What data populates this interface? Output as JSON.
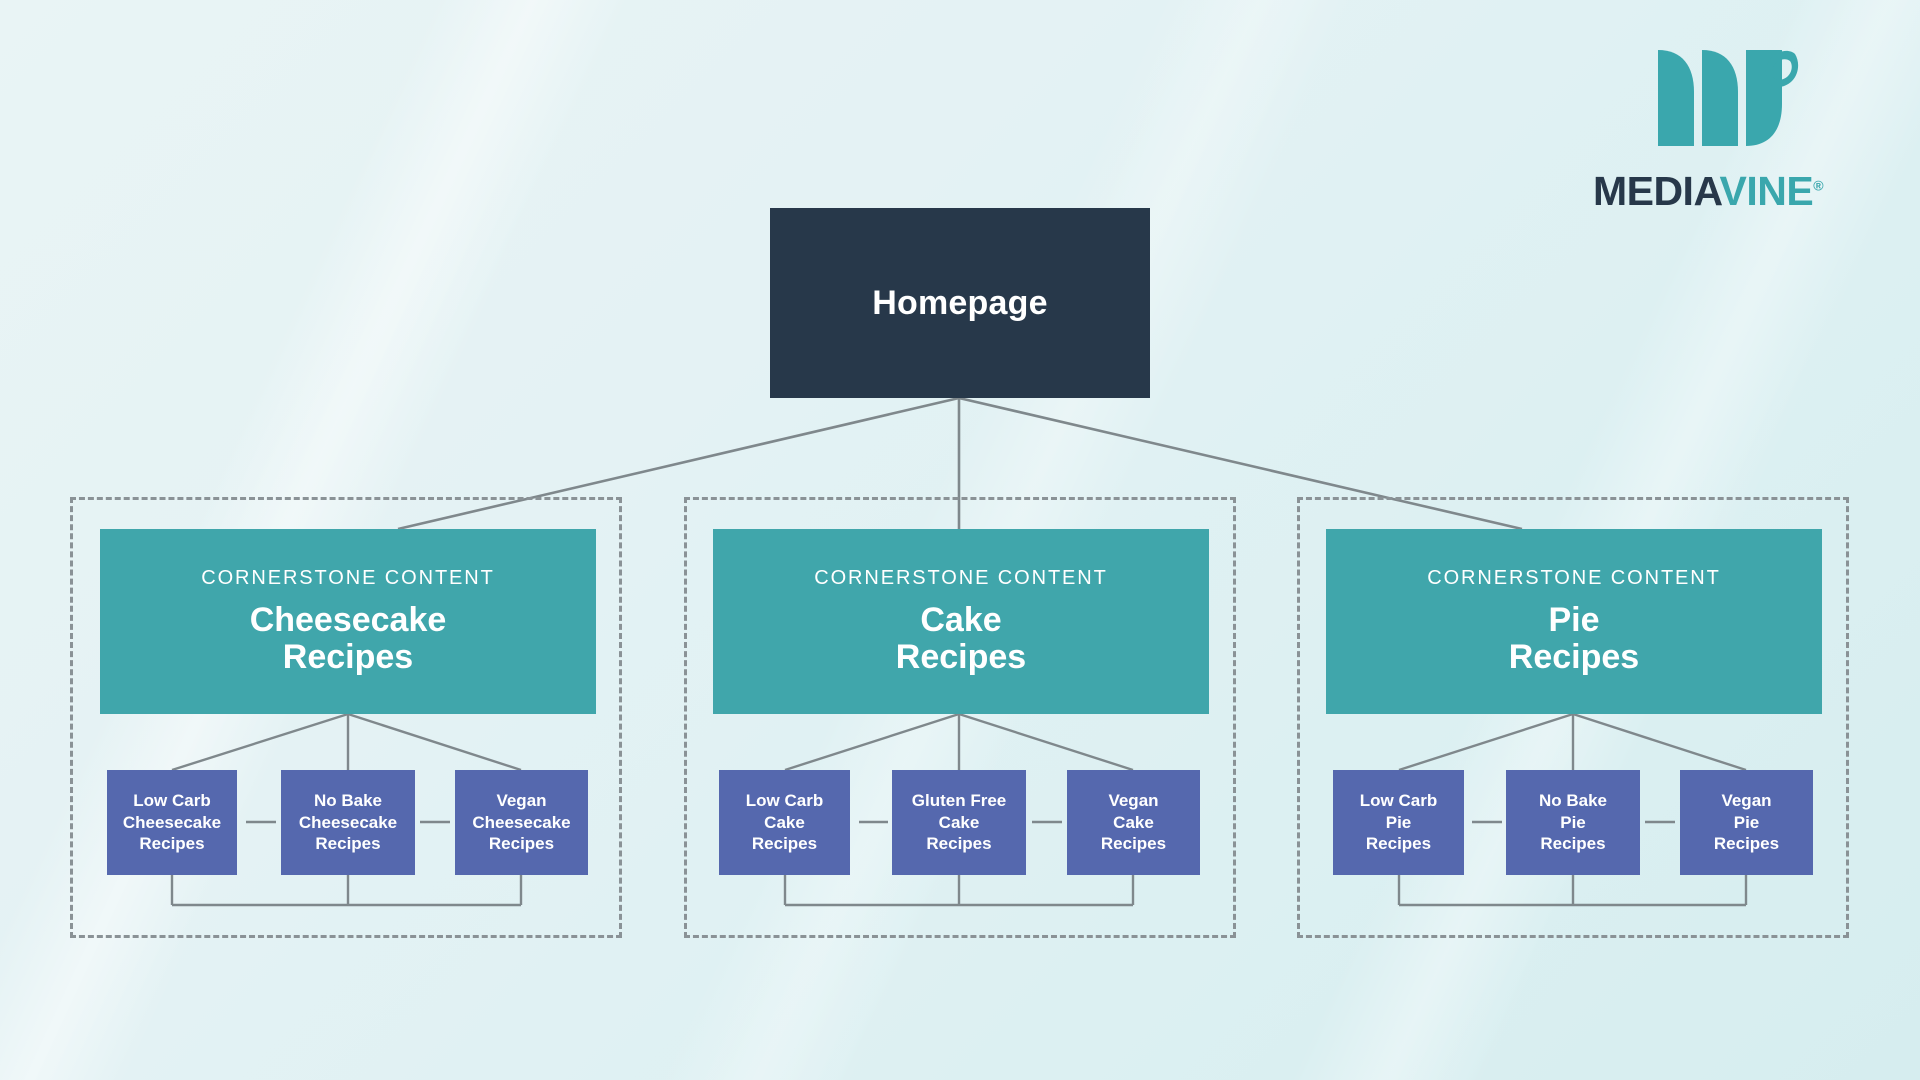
{
  "brand": {
    "logo_mark": "mediavine-mark-icon",
    "name_part_1": "MEDIA",
    "name_part_2": "VINE",
    "registered_mark": "®",
    "colors": {
      "dark": "#27384a",
      "teal": "#3aa7ad"
    }
  },
  "colors": {
    "background_start": "#e9f4f5",
    "background_end": "#d6edef",
    "homepage_box": "#27384a",
    "cornerstone_box": "#40a6ab",
    "leaf_box": "#5568ae",
    "connector_line": "#7f888c",
    "group_border": "#8a9296",
    "text_on_box": "#ffffff"
  },
  "diagram": {
    "root": {
      "label": "Homepage"
    },
    "eyebrow": "CORNERSTONE CONTENT",
    "groups": [
      {
        "id": "cheesecake",
        "cornerstone": {
          "eyebrow": "CORNERSTONE CONTENT",
          "title_line_1": "Cheesecake",
          "title_line_2": "Recipes"
        },
        "children": [
          {
            "line_1": "Low Carb",
            "line_2": "Cheesecake",
            "line_3": "Recipes"
          },
          {
            "line_1": "No Bake",
            "line_2": "Cheesecake",
            "line_3": "Recipes"
          },
          {
            "line_1": "Vegan",
            "line_2": "Cheesecake",
            "line_3": "Recipes"
          }
        ]
      },
      {
        "id": "cake",
        "cornerstone": {
          "eyebrow": "CORNERSTONE CONTENT",
          "title_line_1": "Cake",
          "title_line_2": "Recipes"
        },
        "children": [
          {
            "line_1": "Low Carb",
            "line_2": "Cake",
            "line_3": "Recipes"
          },
          {
            "line_1": "Gluten Free",
            "line_2": "Cake",
            "line_3": "Recipes"
          },
          {
            "line_1": "Vegan",
            "line_2": "Cake",
            "line_3": "Recipes"
          }
        ]
      },
      {
        "id": "pie",
        "cornerstone": {
          "eyebrow": "CORNERSTONE CONTENT",
          "title_line_1": "Pie",
          "title_line_2": "Recipes"
        },
        "children": [
          {
            "line_1": "Low Carb",
            "line_2": "Pie",
            "line_3": "Recipes"
          },
          {
            "line_1": "No Bake",
            "line_2": "Pie",
            "line_3": "Recipes"
          },
          {
            "line_1": "Vegan",
            "line_2": "Pie",
            "line_3": "Recipes"
          }
        ]
      }
    ]
  }
}
